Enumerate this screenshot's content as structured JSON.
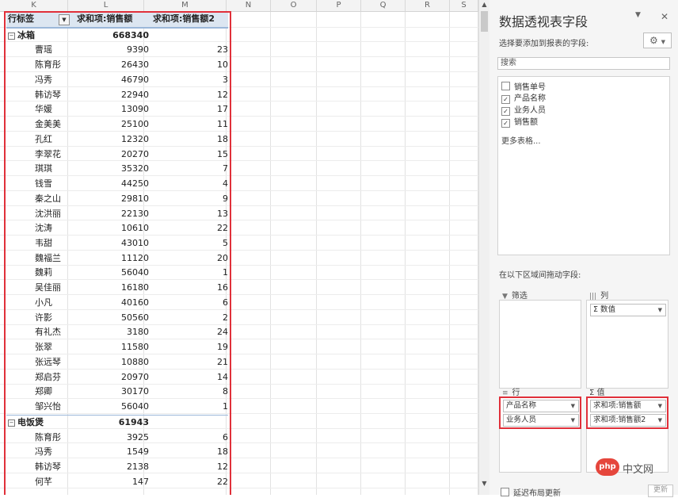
{
  "sheet": {
    "columns": [
      "K",
      "L",
      "M",
      "N",
      "O",
      "P",
      "Q",
      "R",
      "S"
    ]
  },
  "pivot": {
    "header": {
      "row_label": "行标签",
      "col1": "求和项:销售额",
      "col2": "求和项:销售额2"
    },
    "groups": [
      {
        "name": "冰箱",
        "total": "668340",
        "rows": [
          {
            "name": "曹瑶",
            "sales": "9390",
            "rank": "23"
          },
          {
            "name": "陈育彤",
            "sales": "26430",
            "rank": "10"
          },
          {
            "name": "冯秀",
            "sales": "46790",
            "rank": "3"
          },
          {
            "name": "韩访琴",
            "sales": "22940",
            "rank": "12"
          },
          {
            "name": "华媛",
            "sales": "13090",
            "rank": "17"
          },
          {
            "name": "金美美",
            "sales": "25100",
            "rank": "11"
          },
          {
            "name": "孔红",
            "sales": "12320",
            "rank": "18"
          },
          {
            "name": "李翠花",
            "sales": "20270",
            "rank": "15"
          },
          {
            "name": "琪琪",
            "sales": "35320",
            "rank": "7"
          },
          {
            "name": "钱雪",
            "sales": "44250",
            "rank": "4"
          },
          {
            "name": "秦之山",
            "sales": "29810",
            "rank": "9"
          },
          {
            "name": "沈洪丽",
            "sales": "22130",
            "rank": "13"
          },
          {
            "name": "沈涛",
            "sales": "10610",
            "rank": "22"
          },
          {
            "name": "韦甜",
            "sales": "43010",
            "rank": "5"
          },
          {
            "name": "魏福兰",
            "sales": "11120",
            "rank": "20"
          },
          {
            "name": "魏莉",
            "sales": "56040",
            "rank": "1"
          },
          {
            "name": "吴佳丽",
            "sales": "16180",
            "rank": "16"
          },
          {
            "name": "小凡",
            "sales": "40160",
            "rank": "6"
          },
          {
            "name": "许影",
            "sales": "50560",
            "rank": "2"
          },
          {
            "name": "有礼杰",
            "sales": "3180",
            "rank": "24"
          },
          {
            "name": "张翠",
            "sales": "11580",
            "rank": "19"
          },
          {
            "name": "张远琴",
            "sales": "10880",
            "rank": "21"
          },
          {
            "name": "郑启芬",
            "sales": "20970",
            "rank": "14"
          },
          {
            "name": "郑卿",
            "sales": "30170",
            "rank": "8"
          },
          {
            "name": "邹兴怡",
            "sales": "56040",
            "rank": "1"
          }
        ]
      },
      {
        "name": "电饭煲",
        "total": "61943",
        "rows": [
          {
            "name": "陈育彤",
            "sales": "3925",
            "rank": "6"
          },
          {
            "name": "冯秀",
            "sales": "1549",
            "rank": "18"
          },
          {
            "name": "韩访琴",
            "sales": "2138",
            "rank": "12"
          },
          {
            "name": "何芊",
            "sales": "147",
            "rank": "22"
          }
        ]
      }
    ]
  },
  "pane": {
    "title": "数据透视表字段",
    "subtitle": "选择要添加到报表的字段:",
    "search_placeholder": "搜索",
    "fields": [
      {
        "label": "销售单号",
        "checked": false
      },
      {
        "label": "产品名称",
        "checked": true
      },
      {
        "label": "业务人员",
        "checked": true
      },
      {
        "label": "销售额",
        "checked": true
      }
    ],
    "more_tables": "更多表格...",
    "areas_hint": "在以下区域间拖动字段:",
    "areas": {
      "filter": {
        "label": "筛选",
        "items": []
      },
      "columns": {
        "label": "列",
        "items": [
          "Σ 数值"
        ]
      },
      "rows": {
        "label": "行",
        "items": [
          "产品名称",
          "业务人员"
        ]
      },
      "values": {
        "label": "Σ 值",
        "items": [
          "求和项:销售额",
          "求和项:销售额2"
        ]
      }
    },
    "defer_label": "延迟布局更新",
    "update_label": "更新"
  },
  "watermark": {
    "logo": "php",
    "text": "中文网"
  }
}
